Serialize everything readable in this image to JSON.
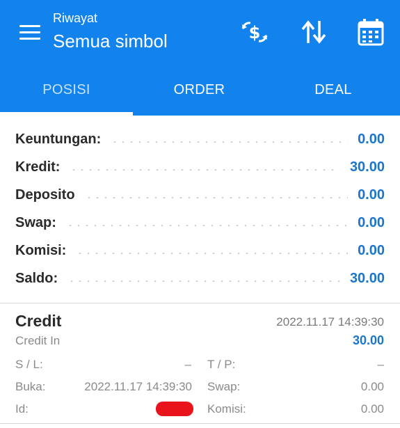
{
  "header": {
    "subtitle": "Riwayat",
    "title": "Semua simbol",
    "background_color": "#1283ec",
    "icons": [
      "menu-icon",
      "currency-exchange-icon",
      "sort-icon",
      "calendar-icon"
    ]
  },
  "tabs": [
    {
      "label": "POSISI",
      "active": true
    },
    {
      "label": "ORDER",
      "active": false
    },
    {
      "label": "DEAL",
      "active": false
    }
  ],
  "summary": [
    {
      "label": "Keuntungan:",
      "value": "0.00"
    },
    {
      "label": "Kredit:",
      "value": "30.00"
    },
    {
      "label": "Deposito",
      "value": "0.00"
    },
    {
      "label": "Swap:",
      "value": "0.00"
    },
    {
      "label": "Komisi:",
      "value": "0.00"
    },
    {
      "label": "Saldo:",
      "value": "30.00"
    }
  ],
  "accent_color": "#1b75c9",
  "deal": {
    "title": "Credit",
    "time": "2022.11.17 14:39:30",
    "subtitle": "Credit In",
    "amount": "30.00",
    "fields": {
      "sl_label": "S / L:",
      "sl_value": "–",
      "tp_label": "T / P:",
      "tp_value": "–",
      "open_label": "Buka:",
      "open_value": "2022.11.17 14:39:30",
      "swap_label": "Swap:",
      "swap_value": "0.00",
      "id_label": "Id:",
      "commission_label": "Komisi:",
      "commission_value": "0.00"
    }
  }
}
